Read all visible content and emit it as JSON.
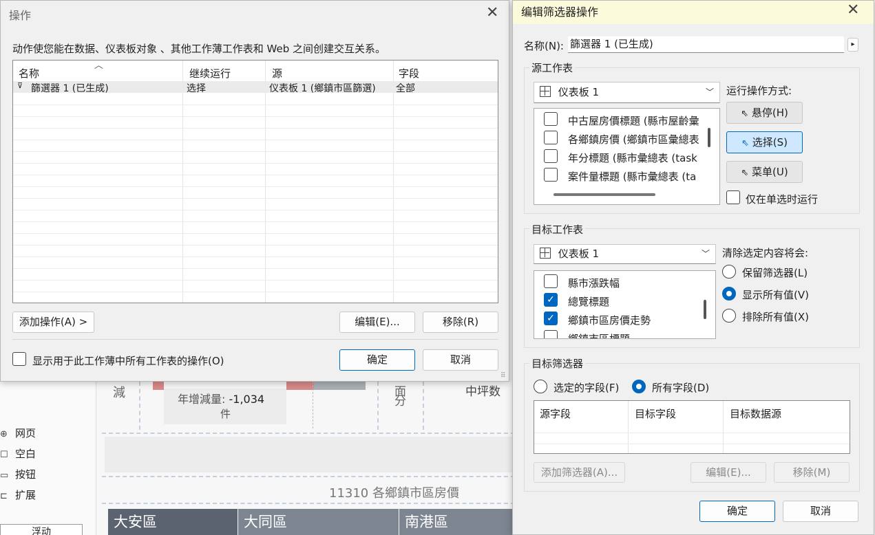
{
  "background": {
    "left_panel": {
      "items": [
        {
          "icon": "globe-icon",
          "glyph": "⊕",
          "label": "网页"
        },
        {
          "icon": "square-icon",
          "glyph": "☐",
          "label": "空白"
        },
        {
          "icon": "button-icon",
          "glyph": "▭",
          "label": "按钮"
        },
        {
          "icon": "extension-icon",
          "glyph": "⊏",
          "label": "扩展"
        }
      ],
      "float_button": "浮动"
    },
    "tile_left_label": "減",
    "tile_metric": "年增減量: ",
    "tile_metric_value": "-1,034",
    "tile_metric_unit": "件",
    "tile_split_1": "面",
    "tile_split_2": "分",
    "tile_right_label": "中坪数",
    "section_title": "11310 各鄉鎮市區房價",
    "district_tabs": [
      "大安區",
      "大同區",
      "南港區"
    ]
  },
  "actions_dialog": {
    "title": "操作",
    "description": "动作使您能在数据、仪表板对象 、其他工作薄工作表和 Web 之间创建交互关系。",
    "columns": [
      "名称",
      "继续运行",
      "源",
      "字段"
    ],
    "rows": [
      {
        "icon": "filter-icon",
        "name": "篩選器 1 (已生成)",
        "run_on": "选择",
        "source": "仪表板 1 (鄉鎮市區篩選)",
        "fields": "全部"
      }
    ],
    "add_action_button": "添加操作(A) >",
    "edit_button": "编辑(E)...",
    "remove_button": "移除(R)",
    "show_all_checkbox": "显示用于此工作薄中所有工作表的操作(O)",
    "ok_button": "确定",
    "cancel_button": "取消"
  },
  "filter_dialog": {
    "title": "编辑筛选器操作",
    "name_label": "名称(N):",
    "name_value": "篩選器 1 (已生成)",
    "source_group": "源工作表",
    "source_combo": "仪表板 1",
    "source_sheets": [
      {
        "label": "中古屋房價標題 (縣市屋齡彙",
        "checked": false
      },
      {
        "label": "各鄉鎮房價 (鄉鎮市區彙總表",
        "checked": false
      },
      {
        "label": "年分標題 (縣市彙總表 (task",
        "checked": false
      },
      {
        "label": "案件量標題 (縣市彙總表 (ta",
        "checked": false
      }
    ],
    "run_action_label": "运行操作方式:",
    "hover_button": "悬停(H)",
    "select_button": "选择(S)",
    "menu_button": "菜单(U)",
    "single_select_checkbox": "仅在单选时运行",
    "target_group": "目标工作表",
    "target_combo": "仪表板 1",
    "target_sheets": [
      {
        "label": "縣市漲跌幅",
        "checked": false
      },
      {
        "label": "總覽標題",
        "checked": true
      },
      {
        "label": "鄉鎮市區房價走勢",
        "checked": true
      },
      {
        "label": "鄉鎮市區標題",
        "checked": false
      }
    ],
    "clear_label": "清除选定内容将会:",
    "clear_options": [
      {
        "label": "保留筛选器(L)",
        "selected": false
      },
      {
        "label": "显示所有值(V)",
        "selected": true
      },
      {
        "label": "排除所有值(X)",
        "selected": false
      }
    ],
    "target_filters_group": "目标筛选器",
    "selected_fields_radio": "选定的字段(F)",
    "all_fields_radio": "所有字段(D)",
    "fields_columns": [
      "源字段",
      "目标字段",
      "目标数据源"
    ],
    "add_filter_button": "添加筛选器(A)...",
    "edit_button": "编辑(E)...",
    "remove_button": "移除(M)",
    "ok_button": "确定",
    "cancel_button": "取消"
  }
}
